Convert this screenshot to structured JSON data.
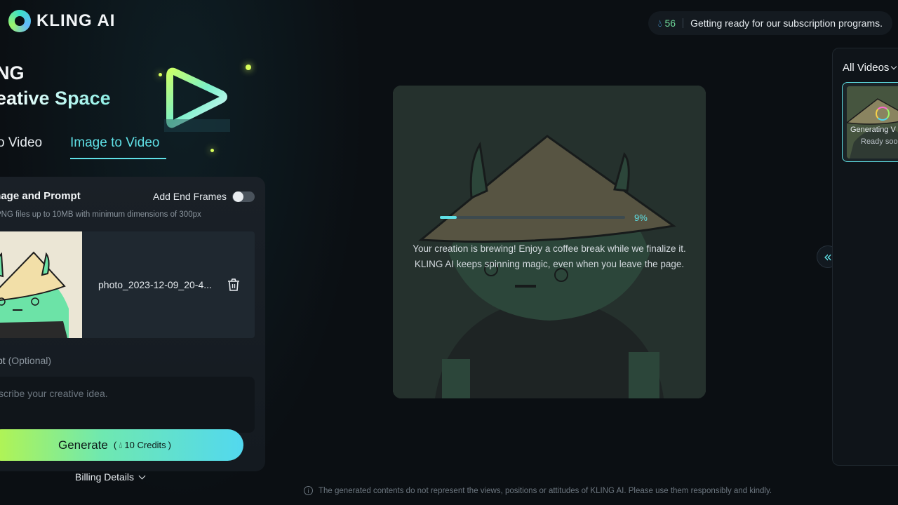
{
  "app": {
    "brand": "KLING AI"
  },
  "header": {
    "credits": "56",
    "message": "Getting ready for our subscription programs."
  },
  "hero": {
    "title_line1": "NG",
    "title_line2": "eative Space"
  },
  "tabs": [
    {
      "label": "o Video",
      "active": false
    },
    {
      "label": "Image to Video",
      "active": true
    }
  ],
  "panel": {
    "section_title": "mage and Prompt",
    "end_frames_label": "Add End Frames",
    "end_frames_on": false,
    "hint": "PNG files up to 10MB with minimum dimensions of 300px",
    "file_name": "photo_2023-12-09_20-4...",
    "prompt_label": "pt",
    "prompt_optional": "(Optional)",
    "prompt_placeholder": "scribe your creative idea.",
    "prompt_value": "",
    "generate_label": "Generate",
    "generate_paren_open": "(",
    "generate_credits": "10 Credits",
    "generate_paren_close": ")",
    "billing_label": "Billing Details"
  },
  "preview": {
    "progress": 0.09,
    "progress_text": "9%",
    "message_line1": "Your creation is brewing! Enjoy a coffee break while we finalize it.",
    "message_line2": "KLING AI keeps spinning magic, even when you leave the page."
  },
  "right_panel": {
    "filter_label": "All Videos",
    "card_status": "Generating V",
    "card_sub": "Ready soo"
  },
  "footer": {
    "disclaimer": "The generated contents do not represent the views, positions or attitudes of KLING AI. Please use them responsibly and kindly."
  },
  "colors": {
    "accent": "#5fe0e6",
    "background": "#0b0f13",
    "credit_green": "#6fd99a"
  },
  "icons": {
    "logo": "kling-logo-icon",
    "credits": "flame-icon",
    "trash": "trash-icon",
    "collapse": "double-chevron-left-icon",
    "info": "info-icon"
  }
}
